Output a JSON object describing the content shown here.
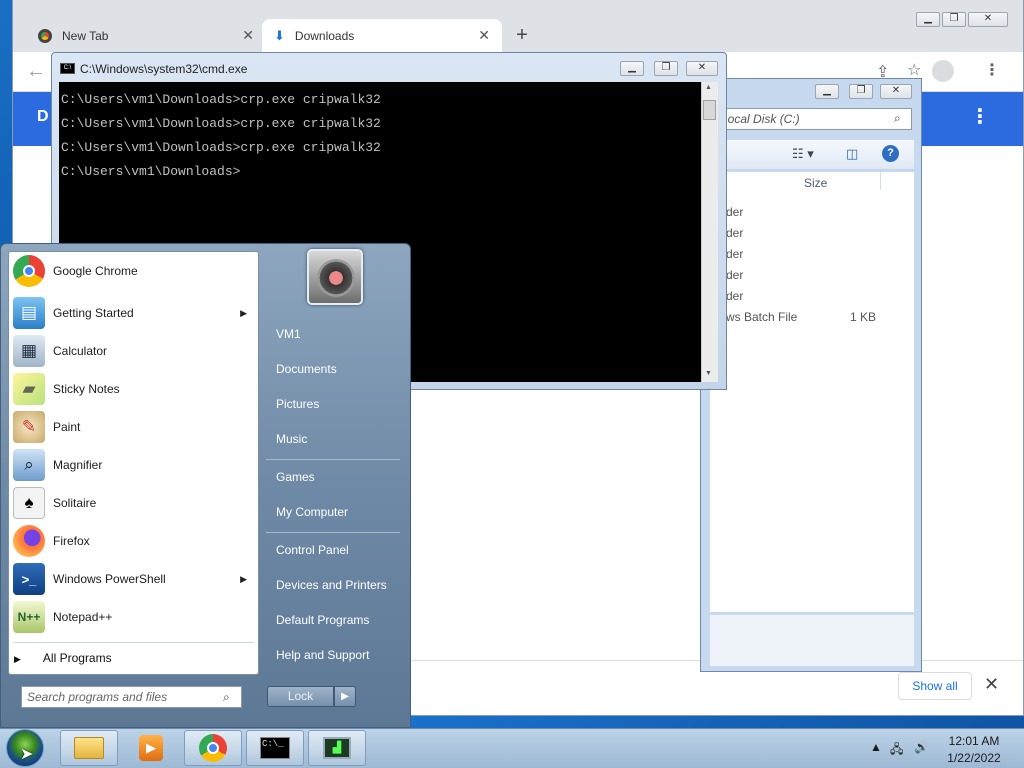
{
  "chrome": {
    "tabs": [
      {
        "label": "New Tab",
        "icon": "chrome-icon"
      },
      {
        "label": "Downloads",
        "icon": "download-icon"
      }
    ],
    "blue_header_text": "D",
    "show_all": "Show all"
  },
  "explorer": {
    "address": "Local Disk (C:)",
    "column_size": "Size",
    "rows": [
      {
        "type": "der",
        "size": ""
      },
      {
        "type": "der",
        "size": ""
      },
      {
        "type": "der",
        "size": ""
      },
      {
        "type": "der",
        "size": ""
      },
      {
        "type": "der",
        "size": ""
      },
      {
        "type": "ws Batch File",
        "size": "1 KB"
      }
    ]
  },
  "cmd": {
    "title": "C:\\Windows\\system32\\cmd.exe",
    "lines": [
      "C:\\Users\\vm1\\Downloads>crp.exe cripwalk32",
      "C:\\Users\\vm1\\Downloads>crp.exe cripwalk32",
      "C:\\Users\\vm1\\Downloads>crp.exe cripwalk32",
      "C:\\Users\\vm1\\Downloads>"
    ]
  },
  "start_menu": {
    "programs": [
      {
        "label": "Google Chrome",
        "icon": "chrome-icon",
        "submenu": false
      },
      {
        "label": "Getting Started",
        "icon": "getting-started-icon",
        "submenu": true
      },
      {
        "label": "Calculator",
        "icon": "calculator-icon",
        "submenu": false
      },
      {
        "label": "Sticky Notes",
        "icon": "sticky-notes-icon",
        "submenu": false
      },
      {
        "label": "Paint",
        "icon": "paint-icon",
        "submenu": false
      },
      {
        "label": "Magnifier",
        "icon": "magnifier-icon",
        "submenu": false
      },
      {
        "label": "Solitaire",
        "icon": "solitaire-icon",
        "submenu": false
      },
      {
        "label": "Firefox",
        "icon": "firefox-icon",
        "submenu": false
      },
      {
        "label": "Windows PowerShell",
        "icon": "powershell-icon",
        "submenu": true
      },
      {
        "label": "Notepad++",
        "icon": "notepadpp-icon",
        "submenu": false
      }
    ],
    "all_programs": "All Programs",
    "search_placeholder": "Search programs and files",
    "right_items": [
      {
        "label": "VM1",
        "group": 1
      },
      {
        "label": "Documents",
        "group": 1
      },
      {
        "label": "Pictures",
        "group": 1
      },
      {
        "label": "Music",
        "group": 1
      },
      {
        "label": "Games",
        "group": 2
      },
      {
        "label": "My Computer",
        "group": 2
      },
      {
        "label": "Control Panel",
        "group": 3
      },
      {
        "label": "Devices and Printers",
        "group": 3
      },
      {
        "label": "Default Programs",
        "group": 3
      },
      {
        "label": "Help and Support",
        "group": 3
      }
    ],
    "lock_label": "Lock"
  },
  "taskbar": {
    "pinned": [
      "explorer-icon",
      "media-player-icon",
      "chrome-icon",
      "cmd-icon",
      "task-manager-icon"
    ],
    "time": "12:01 AM",
    "date": "1/22/2022"
  }
}
